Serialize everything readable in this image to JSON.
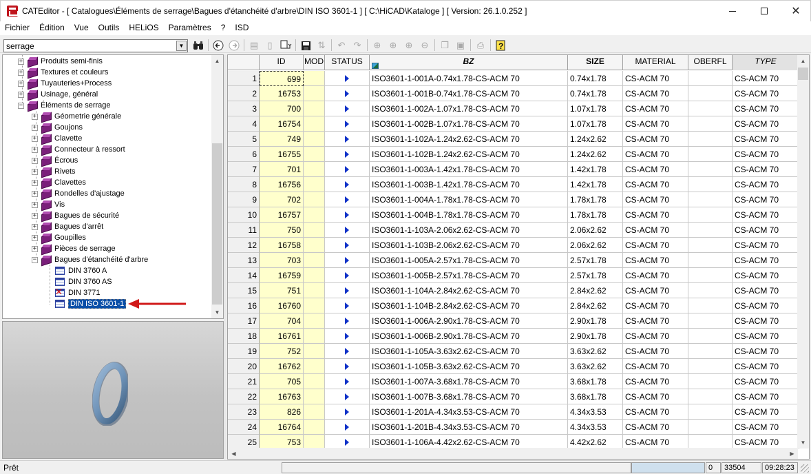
{
  "window": {
    "title": "CATEditor - [ Catalogues\\Éléments de serrage\\Bagues d'étanchéité d'arbre\\DIN ISO 3601-1 ]      [ C:\\HiCAD\\Kataloge ]   [ Version: 26.1.0.252 ]"
  },
  "menu": [
    "Fichier",
    "Édition",
    "Vue",
    "Outils",
    "HELiOS",
    "Paramètres",
    "?",
    "ISD"
  ],
  "search": {
    "value": "serrage"
  },
  "tree": {
    "top_items": [
      "Produits semi-finis",
      "Textures et couleurs",
      "Tuyauteries+Process",
      "Usinage, général"
    ],
    "open_item": "Éléments de serrage",
    "sub_items": [
      "Géometrie générale",
      "Goujons",
      "Clavette",
      "Connecteur à ressort",
      "Écrous",
      "Rivets",
      "Clavettes",
      "Rondelles d'ajustage",
      "Vis",
      "Bagues de sécurité",
      "Bagues d'arrêt",
      "Goupilles",
      "Pièces de serrage"
    ],
    "open_sub_item": "Bagues d'étanchéité d'arbre",
    "tables": [
      "DIN 3760 A",
      "DIN 3760 AS",
      "DIN 3771",
      "DIN ISO 3601-1"
    ],
    "selected_table": "DIN ISO 3601-1"
  },
  "grid": {
    "headers": {
      "id": "ID",
      "mod": "MOD",
      "status": "STATUS",
      "bz": "BZ",
      "size": "SIZE",
      "material": "MATERIAL",
      "oberfl": "OBERFL",
      "type": "TYPE"
    },
    "rows": [
      [
        "1",
        "699",
        "ISO3601-1-001A-0.74x1.78-CS-ACM 70",
        "0.74x1.78",
        "CS-ACM 70",
        "CS-ACM 70"
      ],
      [
        "2",
        "16753",
        "ISO3601-1-001B-0.74x1.78-CS-ACM 70",
        "0.74x1.78",
        "CS-ACM 70",
        "CS-ACM 70"
      ],
      [
        "3",
        "700",
        "ISO3601-1-002A-1.07x1.78-CS-ACM 70",
        "1.07x1.78",
        "CS-ACM 70",
        "CS-ACM 70"
      ],
      [
        "4",
        "16754",
        "ISO3601-1-002B-1.07x1.78-CS-ACM 70",
        "1.07x1.78",
        "CS-ACM 70",
        "CS-ACM 70"
      ],
      [
        "5",
        "749",
        "ISO3601-1-102A-1.24x2.62-CS-ACM 70",
        "1.24x2.62",
        "CS-ACM 70",
        "CS-ACM 70"
      ],
      [
        "6",
        "16755",
        "ISO3601-1-102B-1.24x2.62-CS-ACM 70",
        "1.24x2.62",
        "CS-ACM 70",
        "CS-ACM 70"
      ],
      [
        "7",
        "701",
        "ISO3601-1-003A-1.42x1.78-CS-ACM 70",
        "1.42x1.78",
        "CS-ACM 70",
        "CS-ACM 70"
      ],
      [
        "8",
        "16756",
        "ISO3601-1-003B-1.42x1.78-CS-ACM 70",
        "1.42x1.78",
        "CS-ACM 70",
        "CS-ACM 70"
      ],
      [
        "9",
        "702",
        "ISO3601-1-004A-1.78x1.78-CS-ACM 70",
        "1.78x1.78",
        "CS-ACM 70",
        "CS-ACM 70"
      ],
      [
        "10",
        "16757",
        "ISO3601-1-004B-1.78x1.78-CS-ACM 70",
        "1.78x1.78",
        "CS-ACM 70",
        "CS-ACM 70"
      ],
      [
        "11",
        "750",
        "ISO3601-1-103A-2.06x2.62-CS-ACM 70",
        "2.06x2.62",
        "CS-ACM 70",
        "CS-ACM 70"
      ],
      [
        "12",
        "16758",
        "ISO3601-1-103B-2.06x2.62-CS-ACM 70",
        "2.06x2.62",
        "CS-ACM 70",
        "CS-ACM 70"
      ],
      [
        "13",
        "703",
        "ISO3601-1-005A-2.57x1.78-CS-ACM 70",
        "2.57x1.78",
        "CS-ACM 70",
        "CS-ACM 70"
      ],
      [
        "14",
        "16759",
        "ISO3601-1-005B-2.57x1.78-CS-ACM 70",
        "2.57x1.78",
        "CS-ACM 70",
        "CS-ACM 70"
      ],
      [
        "15",
        "751",
        "ISO3601-1-104A-2.84x2.62-CS-ACM 70",
        "2.84x2.62",
        "CS-ACM 70",
        "CS-ACM 70"
      ],
      [
        "16",
        "16760",
        "ISO3601-1-104B-2.84x2.62-CS-ACM 70",
        "2.84x2.62",
        "CS-ACM 70",
        "CS-ACM 70"
      ],
      [
        "17",
        "704",
        "ISO3601-1-006A-2.90x1.78-CS-ACM 70",
        "2.90x1.78",
        "CS-ACM 70",
        "CS-ACM 70"
      ],
      [
        "18",
        "16761",
        "ISO3601-1-006B-2.90x1.78-CS-ACM 70",
        "2.90x1.78",
        "CS-ACM 70",
        "CS-ACM 70"
      ],
      [
        "19",
        "752",
        "ISO3601-1-105A-3.63x2.62-CS-ACM 70",
        "3.63x2.62",
        "CS-ACM 70",
        "CS-ACM 70"
      ],
      [
        "20",
        "16762",
        "ISO3601-1-105B-3.63x2.62-CS-ACM 70",
        "3.63x2.62",
        "CS-ACM 70",
        "CS-ACM 70"
      ],
      [
        "21",
        "705",
        "ISO3601-1-007A-3.68x1.78-CS-ACM 70",
        "3.68x1.78",
        "CS-ACM 70",
        "CS-ACM 70"
      ],
      [
        "22",
        "16763",
        "ISO3601-1-007B-3.68x1.78-CS-ACM 70",
        "3.68x1.78",
        "CS-ACM 70",
        "CS-ACM 70"
      ],
      [
        "23",
        "826",
        "ISO3601-1-201A-4.34x3.53-CS-ACM 70",
        "4.34x3.53",
        "CS-ACM 70",
        "CS-ACM 70"
      ],
      [
        "24",
        "16764",
        "ISO3601-1-201B-4.34x3.53-CS-ACM 70",
        "4.34x3.53",
        "CS-ACM 70",
        "CS-ACM 70"
      ],
      [
        "25",
        "753",
        "ISO3601-1-106A-4.42x2.62-CS-ACM 70",
        "4.42x2.62",
        "CS-ACM 70",
        "CS-ACM 70"
      ]
    ]
  },
  "status": {
    "text": "Prêt",
    "zero": "0",
    "count": "33504",
    "time": "09:28:23"
  },
  "colors": {
    "id_column": "#ffffcc",
    "status_arrow": "#1032c8",
    "selection": "#0a4fa8",
    "callout_arrow": "#d01818",
    "oring": "#6f93b8"
  },
  "icons": {
    "tree_node": "purple-book-icon",
    "table": "table-icon",
    "missing_table": "table-error-icon",
    "toolbar": [
      "binoculars-icon",
      "back-icon",
      "forward-icon",
      "import-icon",
      "doc-icon",
      "doc-link-icon",
      "save-icon",
      "sort-icon",
      "undo-icon",
      "redo-icon",
      "add-row-icon",
      "add-row-top-icon",
      "add-row-bottom-icon",
      "delete-row-icon",
      "copy-icon",
      "paste-icon",
      "print-icon",
      "help-icon"
    ]
  }
}
